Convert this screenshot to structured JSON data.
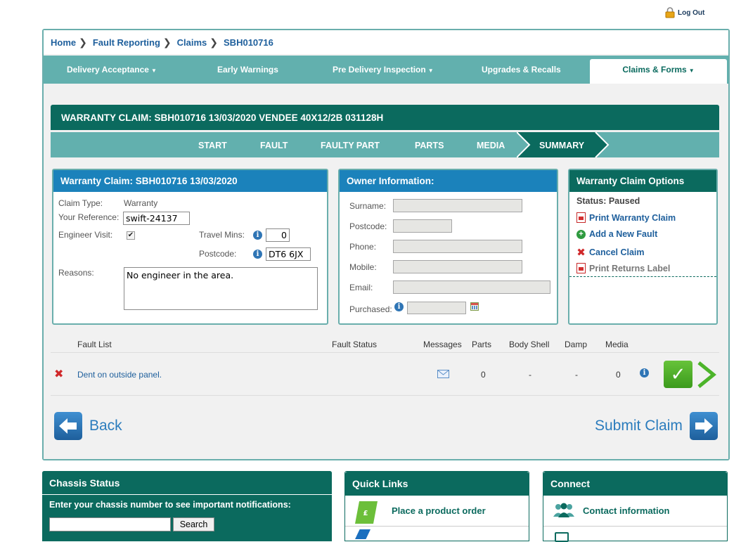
{
  "header": {
    "logout_label": "Log Out"
  },
  "breadcrumb": [
    "Home",
    "Fault Reporting",
    "Claims",
    "SBH010716"
  ],
  "nav": {
    "items": [
      "Delivery Acceptance",
      "Early Warnings",
      "Pre Delivery Inspection",
      "Upgrades & Recalls"
    ],
    "active": "Claims & Forms"
  },
  "claim": {
    "title": "WARRANTY CLAIM: SBH010716 13/03/2020 VENDEE 40X12/2B 031128H",
    "steps": [
      "START",
      "FAULT",
      "FAULTY PART",
      "PARTS",
      "MEDIA",
      "SUMMARY"
    ]
  },
  "warranty_panel": {
    "title": "Warranty Claim: SBH010716 13/03/2020",
    "claim_type_label": "Claim Type:",
    "claim_type_value": "Warranty",
    "reference_label": "Your Reference:",
    "reference_value": "swift-24137",
    "engineer_visit_label": "Engineer Visit:",
    "travel_mins_label": "Travel Mins:",
    "travel_mins_value": "0",
    "postcode_label": "Postcode:",
    "postcode_value": "DT6 6JX",
    "reasons_label": "Reasons:",
    "reasons_value": "No engineer in the area."
  },
  "owner_panel": {
    "title": "Owner Information:",
    "fields": [
      "Surname:",
      "Postcode:",
      "Phone:",
      "Mobile:",
      "Email:",
      "Purchased:"
    ]
  },
  "options_panel": {
    "title": "Warranty Claim Options",
    "status": "Status: Paused",
    "links": [
      "Print Warranty Claim",
      "Add a New Fault",
      "Cancel Claim",
      "Print Returns Label"
    ]
  },
  "faults": {
    "headers": [
      "Fault List",
      "Fault Status",
      "Messages",
      "Parts",
      "Body Shell",
      "Damp",
      "Media"
    ],
    "rows": [
      {
        "name": "Dent on outside panel.",
        "status": "",
        "parts": "0",
        "body_shell": "-",
        "damp": "-",
        "media": "0"
      }
    ]
  },
  "actions": {
    "back": "Back",
    "submit": "Submit Claim"
  },
  "bottom": {
    "chassis": {
      "title": "Chassis Status",
      "prompt": "Enter your chassis number to see important notifications:",
      "search": "Search"
    },
    "quick_links": {
      "title": "Quick Links",
      "item": "Place a product order"
    },
    "connect": {
      "title": "Connect",
      "item": "Contact information"
    }
  },
  "colors": {
    "teal_dark": "#0b6a5e",
    "teal_light": "#62b0ae",
    "blue": "#1b82bb",
    "link": "#1e5f9c"
  }
}
